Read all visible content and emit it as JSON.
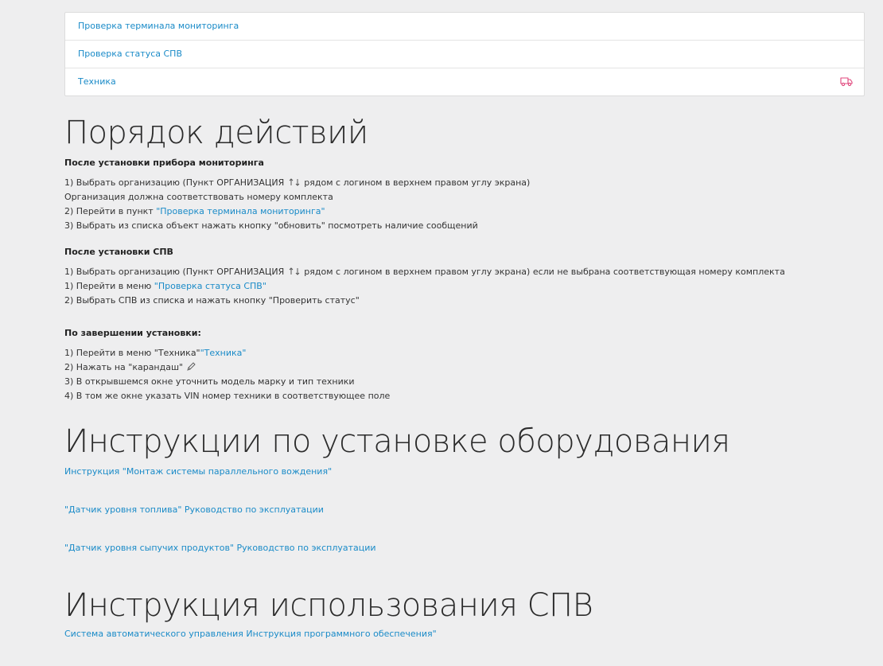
{
  "menu": {
    "items": [
      {
        "label": "Проверка терминала мониторинга"
      },
      {
        "label": "Проверка статуса СПВ"
      },
      {
        "label": "Техника",
        "icon": "truck-icon"
      }
    ]
  },
  "section1": {
    "title": "Порядок действий",
    "block1": {
      "heading": "После установки прибора мониторинга",
      "line1_before": "1) Выбрать организацию (Пункт ОРГАНИЗАЦИЯ",
      "line1_after": "рядом с логином в верхнем правом углу экрана)",
      "line2": "Организация должна соответствовать номеру комплекта",
      "line3_before": "2) Перейти в пункт ",
      "line3_link": "\"Проверка терминала мониторинга\"",
      "line4": "3) Выбрать из списка объект нажать кнопку \"обновить\" посмотреть наличие сообщений"
    },
    "block2": {
      "heading": "После установки СПВ",
      "line1_before": "1) Выбрать организацию (Пункт ОРГАНИЗАЦИЯ",
      "line1_after": "рядом с логином в верхнем правом углу экрана) если не выбрана соответствующая номеру комплекта",
      "line2_before": "1) Перейти в меню ",
      "line2_link": "\"Проверка статуса СПВ\"",
      "line3": "2) Выбрать СПВ из списка и нажать кнопку \"Проверить статус\""
    },
    "block3": {
      "heading": "По завершении установки:",
      "line1_before": "1) Перейти в меню \"Техника\"",
      "line1_link": "\"Техника\"",
      "line2": "2) Нажать на \"карандаш\"",
      "line3": "3) В открывшемся окне уточнить модель марку и тип техники",
      "line4": "4) В том же окне указать VIN номер техники в соответствующее поле"
    }
  },
  "section2": {
    "title": "Инструкции по установке оборудования",
    "links": [
      "Инструкция \"Монтаж системы параллельного вождения\"",
      "\"Датчик уровня топлива\" Руководство по эксплуатации",
      "\"Датчик уровня сыпучих продуктов\" Руководство по эксплуатации"
    ]
  },
  "section3": {
    "title": "Инструкция использования СПВ",
    "link": "Система автоматического управления Инструкция программного обеспечения\""
  },
  "colors": {
    "link": "#1a8bc8",
    "truck_icon": "#e0457b",
    "background": "#eeeeef"
  }
}
